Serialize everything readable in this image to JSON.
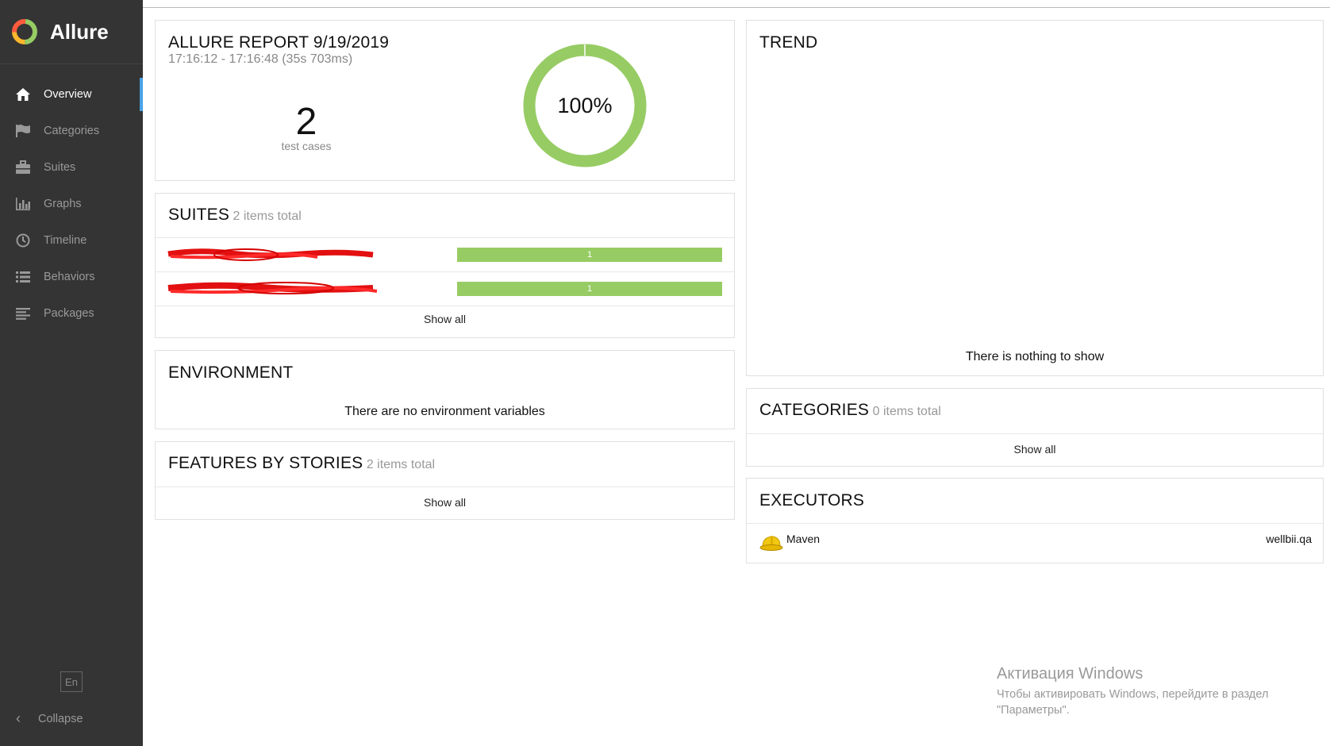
{
  "sidebar": {
    "brand": "Allure",
    "items": [
      {
        "label": "Overview",
        "icon": "home-icon"
      },
      {
        "label": "Categories",
        "icon": "flag-icon"
      },
      {
        "label": "Suites",
        "icon": "briefcase-icon"
      },
      {
        "label": "Graphs",
        "icon": "bar-chart-icon"
      },
      {
        "label": "Timeline",
        "icon": "clock-icon"
      },
      {
        "label": "Behaviors",
        "icon": "list-icon"
      },
      {
        "label": "Packages",
        "icon": "align-left-icon"
      }
    ],
    "language": "En",
    "collapse": "Collapse",
    "active_color": "#4aa2e6"
  },
  "summary": {
    "title": "ALLURE REPORT 9/19/2019",
    "time": "17:16:12 - 17:16:48 (35s 703ms)",
    "count": "2",
    "count_label": "test cases",
    "percent": "100%",
    "passed_fraction": 1.0,
    "passed_color": "#97cc64"
  },
  "suites": {
    "title": "SUITES",
    "subtitle": "2 items total",
    "rows": [
      {
        "bar_label": "1",
        "value": 1
      },
      {
        "bar_label": "1",
        "value": 1
      }
    ],
    "show_all": "Show all"
  },
  "environment": {
    "title": "ENVIRONMENT",
    "message": "There are no environment variables"
  },
  "features": {
    "title": "FEATURES BY STORIES",
    "subtitle": "2 items total",
    "show_all": "Show all"
  },
  "trend": {
    "title": "TREND",
    "message": "There is nothing to show"
  },
  "categories": {
    "title": "CATEGORIES",
    "subtitle": "0 items total",
    "show_all": "Show all"
  },
  "executors": {
    "title": "EXECUTORS",
    "items": [
      {
        "name": "Maven",
        "host": "wellbii.qa",
        "icon": "hard-hat-icon"
      }
    ]
  },
  "watermark": {
    "line1": "Активация Windows",
    "line2": "Чтобы активировать Windows, перейдите в раздел",
    "line3": "\"Параметры\"."
  }
}
